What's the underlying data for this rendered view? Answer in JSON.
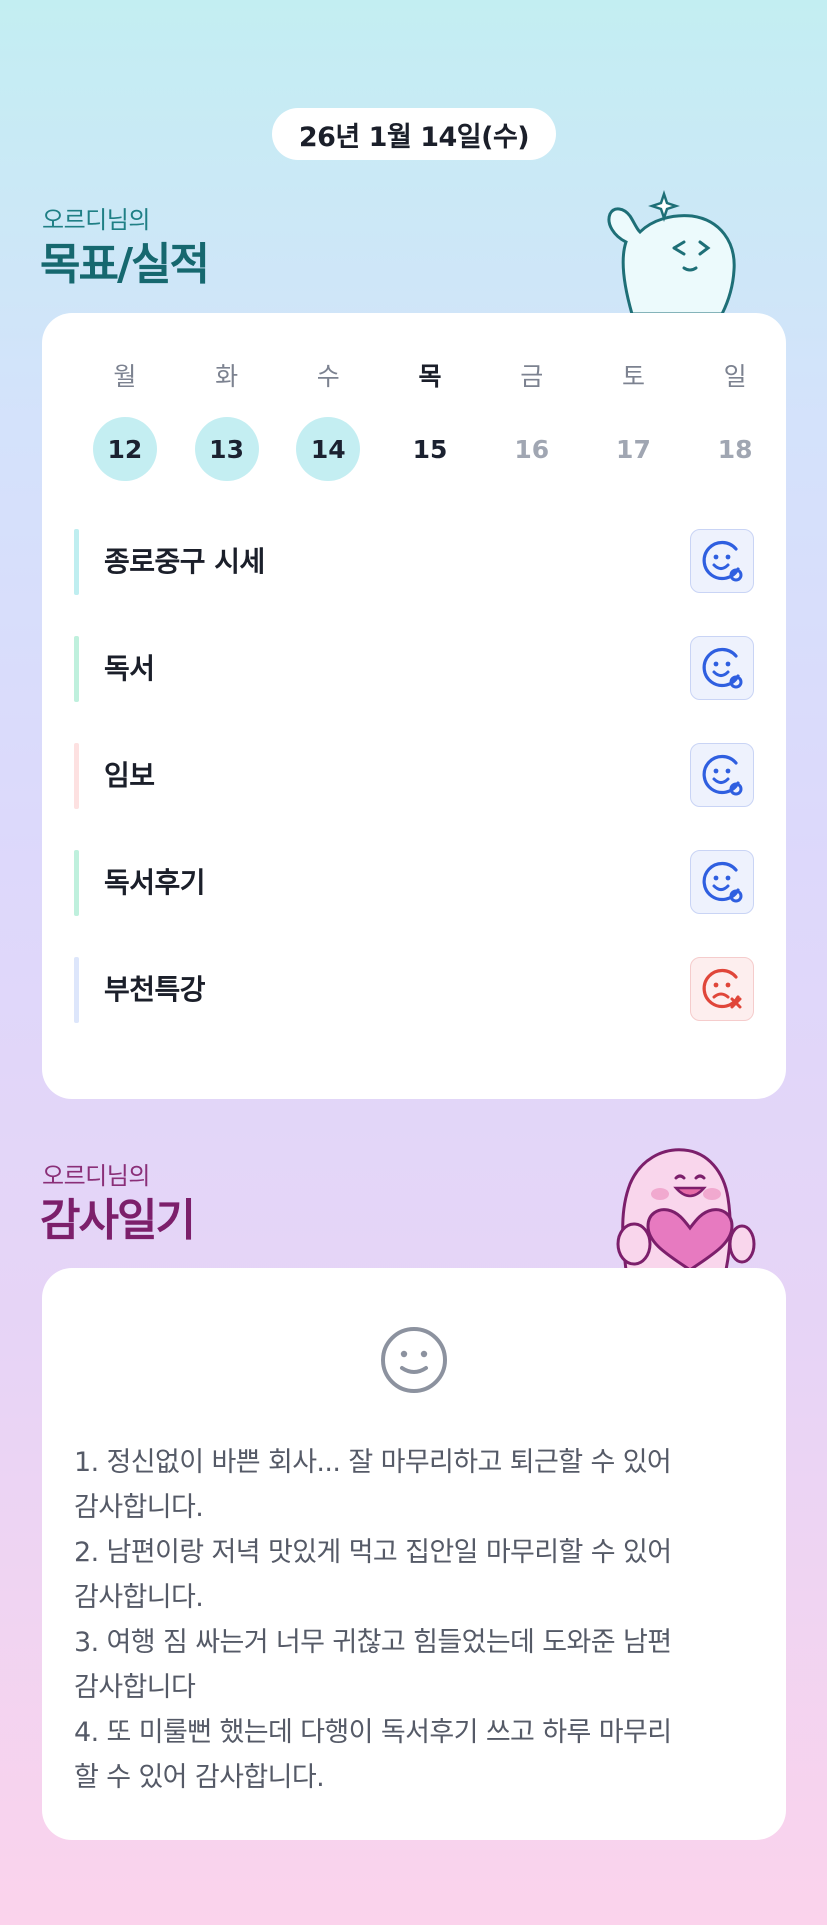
{
  "header": {
    "date": "26년 1월 14일(수)"
  },
  "goals_section": {
    "subtitle": "오르디님의",
    "title": "목표/실적",
    "week": [
      {
        "name": "월",
        "num": "12",
        "state": "done"
      },
      {
        "name": "화",
        "num": "13",
        "state": "done"
      },
      {
        "name": "수",
        "num": "14",
        "state": "done"
      },
      {
        "name": "목",
        "num": "15",
        "state": "today"
      },
      {
        "name": "금",
        "num": "16",
        "state": "future"
      },
      {
        "name": "토",
        "num": "17",
        "state": "future"
      },
      {
        "name": "일",
        "num": "18",
        "state": "future"
      }
    ],
    "items": [
      {
        "label": "종로중구 시세",
        "bar_color": "#bfeef0",
        "status": "achieved"
      },
      {
        "label": "독서",
        "bar_color": "#bff0dd",
        "status": "achieved"
      },
      {
        "label": "임보",
        "bar_color": "#fde1e1",
        "status": "achieved"
      },
      {
        "label": "독서후기",
        "bar_color": "#bff0dd",
        "status": "achieved"
      },
      {
        "label": "부천특강",
        "bar_color": "#dde6fb",
        "status": "failed"
      }
    ]
  },
  "thanks_section": {
    "subtitle": "오르디님의",
    "title": "감사일기",
    "lines": [
      "1. 정신없이 바쁜 회사... 잘 마무리하고 퇴근할 수 있어",
      "감사합니다.",
      "2. 남편이랑 저녁 맛있게 먹고 집안일 마무리할 수 있어",
      "감사합니다.",
      "3. 여행 짐 싸는거 너무 귀찮고 힘들었는데 도와준 남편",
      "감사합니다",
      "4. 또 미룰뻔 했는데 다행이 독서후기 쓰고 하루 마무리",
      "할 수 있어 감사합니다."
    ]
  },
  "colors": {
    "accent_teal": "#16686f",
    "accent_purple": "#7c1f6b",
    "status_good": "#2f5fe0",
    "status_bad": "#e0463a"
  },
  "icons": {
    "goal_achieved": "smile-face-icon",
    "goal_failed": "sad-face-x-icon",
    "diary_mood": "neutral-smile-icon"
  }
}
